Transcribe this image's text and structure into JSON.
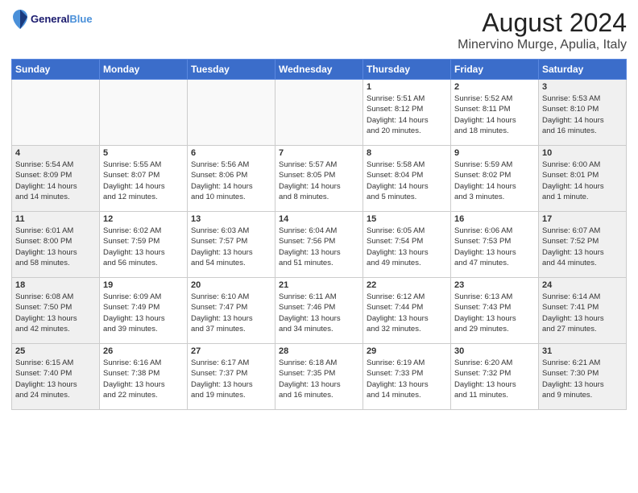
{
  "header": {
    "logo_line1": "General",
    "logo_line2": "Blue",
    "main_title": "August 2024",
    "sub_title": "Minervino Murge, Apulia, Italy"
  },
  "weekdays": [
    "Sunday",
    "Monday",
    "Tuesday",
    "Wednesday",
    "Thursday",
    "Friday",
    "Saturday"
  ],
  "weeks": [
    [
      {
        "day": "",
        "info": ""
      },
      {
        "day": "",
        "info": ""
      },
      {
        "day": "",
        "info": ""
      },
      {
        "day": "",
        "info": ""
      },
      {
        "day": "1",
        "info": "Sunrise: 5:51 AM\nSunset: 8:12 PM\nDaylight: 14 hours\nand 20 minutes."
      },
      {
        "day": "2",
        "info": "Sunrise: 5:52 AM\nSunset: 8:11 PM\nDaylight: 14 hours\nand 18 minutes."
      },
      {
        "day": "3",
        "info": "Sunrise: 5:53 AM\nSunset: 8:10 PM\nDaylight: 14 hours\nand 16 minutes."
      }
    ],
    [
      {
        "day": "4",
        "info": "Sunrise: 5:54 AM\nSunset: 8:09 PM\nDaylight: 14 hours\nand 14 minutes."
      },
      {
        "day": "5",
        "info": "Sunrise: 5:55 AM\nSunset: 8:07 PM\nDaylight: 14 hours\nand 12 minutes."
      },
      {
        "day": "6",
        "info": "Sunrise: 5:56 AM\nSunset: 8:06 PM\nDaylight: 14 hours\nand 10 minutes."
      },
      {
        "day": "7",
        "info": "Sunrise: 5:57 AM\nSunset: 8:05 PM\nDaylight: 14 hours\nand 8 minutes."
      },
      {
        "day": "8",
        "info": "Sunrise: 5:58 AM\nSunset: 8:04 PM\nDaylight: 14 hours\nand 5 minutes."
      },
      {
        "day": "9",
        "info": "Sunrise: 5:59 AM\nSunset: 8:02 PM\nDaylight: 14 hours\nand 3 minutes."
      },
      {
        "day": "10",
        "info": "Sunrise: 6:00 AM\nSunset: 8:01 PM\nDaylight: 14 hours\nand 1 minute."
      }
    ],
    [
      {
        "day": "11",
        "info": "Sunrise: 6:01 AM\nSunset: 8:00 PM\nDaylight: 13 hours\nand 58 minutes."
      },
      {
        "day": "12",
        "info": "Sunrise: 6:02 AM\nSunset: 7:59 PM\nDaylight: 13 hours\nand 56 minutes."
      },
      {
        "day": "13",
        "info": "Sunrise: 6:03 AM\nSunset: 7:57 PM\nDaylight: 13 hours\nand 54 minutes."
      },
      {
        "day": "14",
        "info": "Sunrise: 6:04 AM\nSunset: 7:56 PM\nDaylight: 13 hours\nand 51 minutes."
      },
      {
        "day": "15",
        "info": "Sunrise: 6:05 AM\nSunset: 7:54 PM\nDaylight: 13 hours\nand 49 minutes."
      },
      {
        "day": "16",
        "info": "Sunrise: 6:06 AM\nSunset: 7:53 PM\nDaylight: 13 hours\nand 47 minutes."
      },
      {
        "day": "17",
        "info": "Sunrise: 6:07 AM\nSunset: 7:52 PM\nDaylight: 13 hours\nand 44 minutes."
      }
    ],
    [
      {
        "day": "18",
        "info": "Sunrise: 6:08 AM\nSunset: 7:50 PM\nDaylight: 13 hours\nand 42 minutes."
      },
      {
        "day": "19",
        "info": "Sunrise: 6:09 AM\nSunset: 7:49 PM\nDaylight: 13 hours\nand 39 minutes."
      },
      {
        "day": "20",
        "info": "Sunrise: 6:10 AM\nSunset: 7:47 PM\nDaylight: 13 hours\nand 37 minutes."
      },
      {
        "day": "21",
        "info": "Sunrise: 6:11 AM\nSunset: 7:46 PM\nDaylight: 13 hours\nand 34 minutes."
      },
      {
        "day": "22",
        "info": "Sunrise: 6:12 AM\nSunset: 7:44 PM\nDaylight: 13 hours\nand 32 minutes."
      },
      {
        "day": "23",
        "info": "Sunrise: 6:13 AM\nSunset: 7:43 PM\nDaylight: 13 hours\nand 29 minutes."
      },
      {
        "day": "24",
        "info": "Sunrise: 6:14 AM\nSunset: 7:41 PM\nDaylight: 13 hours\nand 27 minutes."
      }
    ],
    [
      {
        "day": "25",
        "info": "Sunrise: 6:15 AM\nSunset: 7:40 PM\nDaylight: 13 hours\nand 24 minutes."
      },
      {
        "day": "26",
        "info": "Sunrise: 6:16 AM\nSunset: 7:38 PM\nDaylight: 13 hours\nand 22 minutes."
      },
      {
        "day": "27",
        "info": "Sunrise: 6:17 AM\nSunset: 7:37 PM\nDaylight: 13 hours\nand 19 minutes."
      },
      {
        "day": "28",
        "info": "Sunrise: 6:18 AM\nSunset: 7:35 PM\nDaylight: 13 hours\nand 16 minutes."
      },
      {
        "day": "29",
        "info": "Sunrise: 6:19 AM\nSunset: 7:33 PM\nDaylight: 13 hours\nand 14 minutes."
      },
      {
        "day": "30",
        "info": "Sunrise: 6:20 AM\nSunset: 7:32 PM\nDaylight: 13 hours\nand 11 minutes."
      },
      {
        "day": "31",
        "info": "Sunrise: 6:21 AM\nSunset: 7:30 PM\nDaylight: 13 hours\nand 9 minutes."
      }
    ]
  ]
}
